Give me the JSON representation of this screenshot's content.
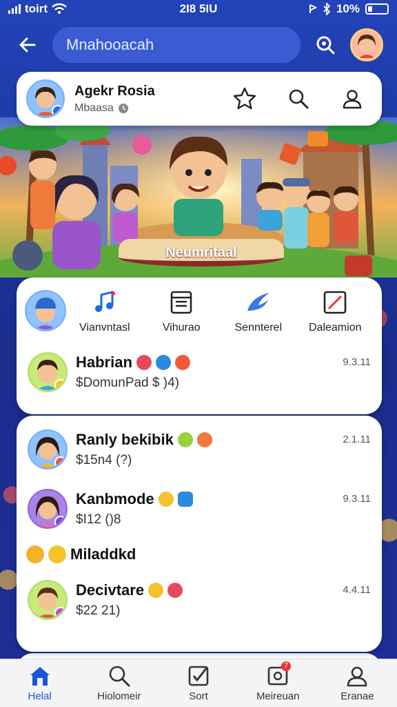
{
  "status_bar": {
    "carrier": "toirt",
    "time": "2I8 5IU",
    "battery": "10%"
  },
  "top_bar": {
    "search_value": "Mnahooacah"
  },
  "profile": {
    "name": "Agekr Rosia",
    "subtitle": "Mbaasa"
  },
  "banner": {
    "caption": "Neumritaal"
  },
  "quick_actions": [
    {
      "label": "Vianvntasl",
      "icon": "music-note-icon"
    },
    {
      "label": "Vihurao",
      "icon": "calendar-icon"
    },
    {
      "label": "Sennterel",
      "icon": "swoosh-icon"
    },
    {
      "label": "Daleamion",
      "icon": "edit-square-icon"
    }
  ],
  "featured_chat": {
    "name": "Habrian",
    "preview": "$DomunPad $ )4)",
    "time": "9.3.11"
  },
  "chats": [
    {
      "name": "Ranly bekibik",
      "preview": "$15n4 (?)",
      "time": "2.1.11"
    },
    {
      "name": "Kanbmode",
      "preview": "$I12 ()8",
      "time": "9.3.11"
    }
  ],
  "section": {
    "label": "Miladdkd"
  },
  "chats_after": [
    {
      "name": "Decivtare",
      "preview": "$22 21)",
      "time": "4.4.11"
    }
  ],
  "bottom_nav": [
    {
      "label": "Helal",
      "icon": "home-icon",
      "active": true
    },
    {
      "label": "Hiolomeir",
      "icon": "search-icon",
      "active": false
    },
    {
      "label": "Sort",
      "icon": "check-square-icon",
      "active": false
    },
    {
      "label": "Meireuan",
      "icon": "notification-icon",
      "active": false,
      "badge": "7"
    },
    {
      "label": "Eranae",
      "icon": "profile-icon",
      "active": false
    }
  ],
  "colors": {
    "primary": "#1a55d6",
    "background": "#1b2f8f",
    "card": "#ffffff"
  }
}
